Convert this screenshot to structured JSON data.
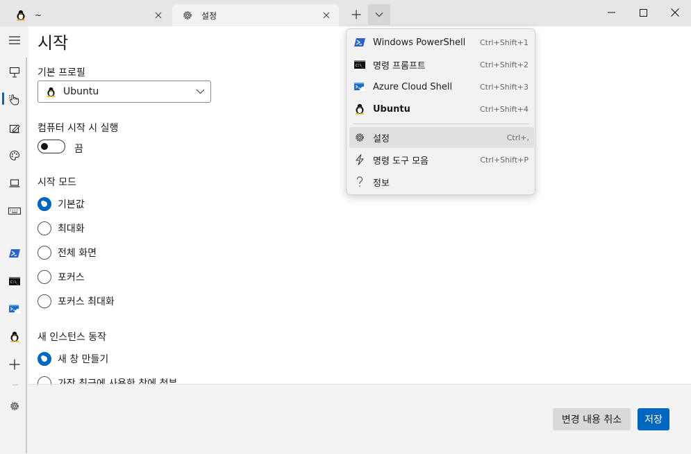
{
  "window": {
    "tabs": [
      {
        "label": "~",
        "icon": "ubuntu-tux-icon"
      },
      {
        "label": "설정",
        "icon": "gear-icon"
      }
    ],
    "caption_buttons": [
      "minimize",
      "maximize",
      "close"
    ]
  },
  "page": {
    "title": "시작",
    "default_profile_label": "기본 프로필",
    "default_profile_value": "Ubuntu",
    "launch_on_startup_label": "컴퓨터 시작 시 실행",
    "launch_on_startup_state": "끔",
    "launch_mode_label": "시작 모드",
    "launch_mode_options": [
      {
        "label": "기본값",
        "selected": true
      },
      {
        "label": "최대화",
        "selected": false
      },
      {
        "label": "전체 화면",
        "selected": false
      },
      {
        "label": "포커스",
        "selected": false
      },
      {
        "label": "포커스 최대화",
        "selected": false
      }
    ],
    "new_instance_label": "새 인스턴스 동작",
    "new_instance_options": [
      {
        "label": "새 창 만들기",
        "selected": true
      },
      {
        "label": "가장 최근에 사용한 창에 첨부",
        "selected": false
      }
    ]
  },
  "footer": {
    "discard_label": "변경 내용 취소",
    "save_label": "저장"
  },
  "menu": {
    "items": [
      {
        "label": "Windows PowerShell",
        "shortcut": "Ctrl+Shift+1",
        "icon": "powershell-icon"
      },
      {
        "label": "명령 프롬프트",
        "shortcut": "Ctrl+Shift+2",
        "icon": "cmd-icon"
      },
      {
        "label": "Azure Cloud Shell",
        "shortcut": "Ctrl+Shift+3",
        "icon": "azure-cloud-shell-icon"
      },
      {
        "label": "Ubuntu",
        "shortcut": "Ctrl+Shift+4",
        "icon": "ubuntu-tux-icon"
      },
      {
        "label": "설정",
        "shortcut": "Ctrl+,",
        "icon": "gear-icon"
      },
      {
        "label": "명령 도구 모음",
        "shortcut": "Ctrl+Shift+P",
        "icon": "lightning-icon"
      },
      {
        "label": "정보",
        "shortcut": "",
        "icon": "question-icon"
      }
    ]
  },
  "colors": {
    "accent": "#0067c0",
    "titlebar": "#e6e6e6",
    "panel": "#f3f3f3",
    "menu": "#f2f2f2"
  }
}
